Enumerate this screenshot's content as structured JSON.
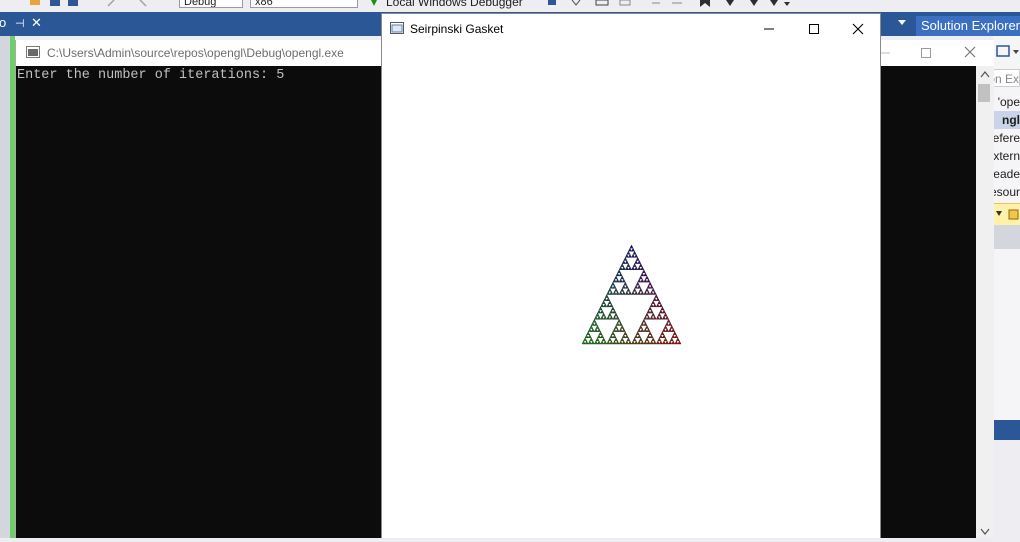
{
  "vs": {
    "toolbar": {
      "config_combo": "Debug",
      "platform_combo": "x86",
      "run_label": "Local Windows Debugger"
    },
    "tabbar": {
      "left_glyph": "o",
      "pin_glyph": "⊣",
      "close_glyph": "✕"
    },
    "solution_explorer": {
      "header": "Solution Explorer",
      "search_stub": "on Ex",
      "items": [
        "'ope",
        "ngl",
        "efere",
        "xtern",
        "leade",
        "esour"
      ]
    }
  },
  "console": {
    "title_path": "C:\\Users\\Admin\\source\\repos\\opengl\\Debug\\opengl.exe",
    "output_line": "Enter the number of iterations: 5",
    "colors": {
      "background": "#0c0c0c",
      "text": "#c0c0c0"
    }
  },
  "gasket_window": {
    "title": "Seirpinski Gasket",
    "iterations": 5,
    "vertex_colors": [
      "#00aa00",
      "#cc0000",
      "#1010a0"
    ]
  }
}
